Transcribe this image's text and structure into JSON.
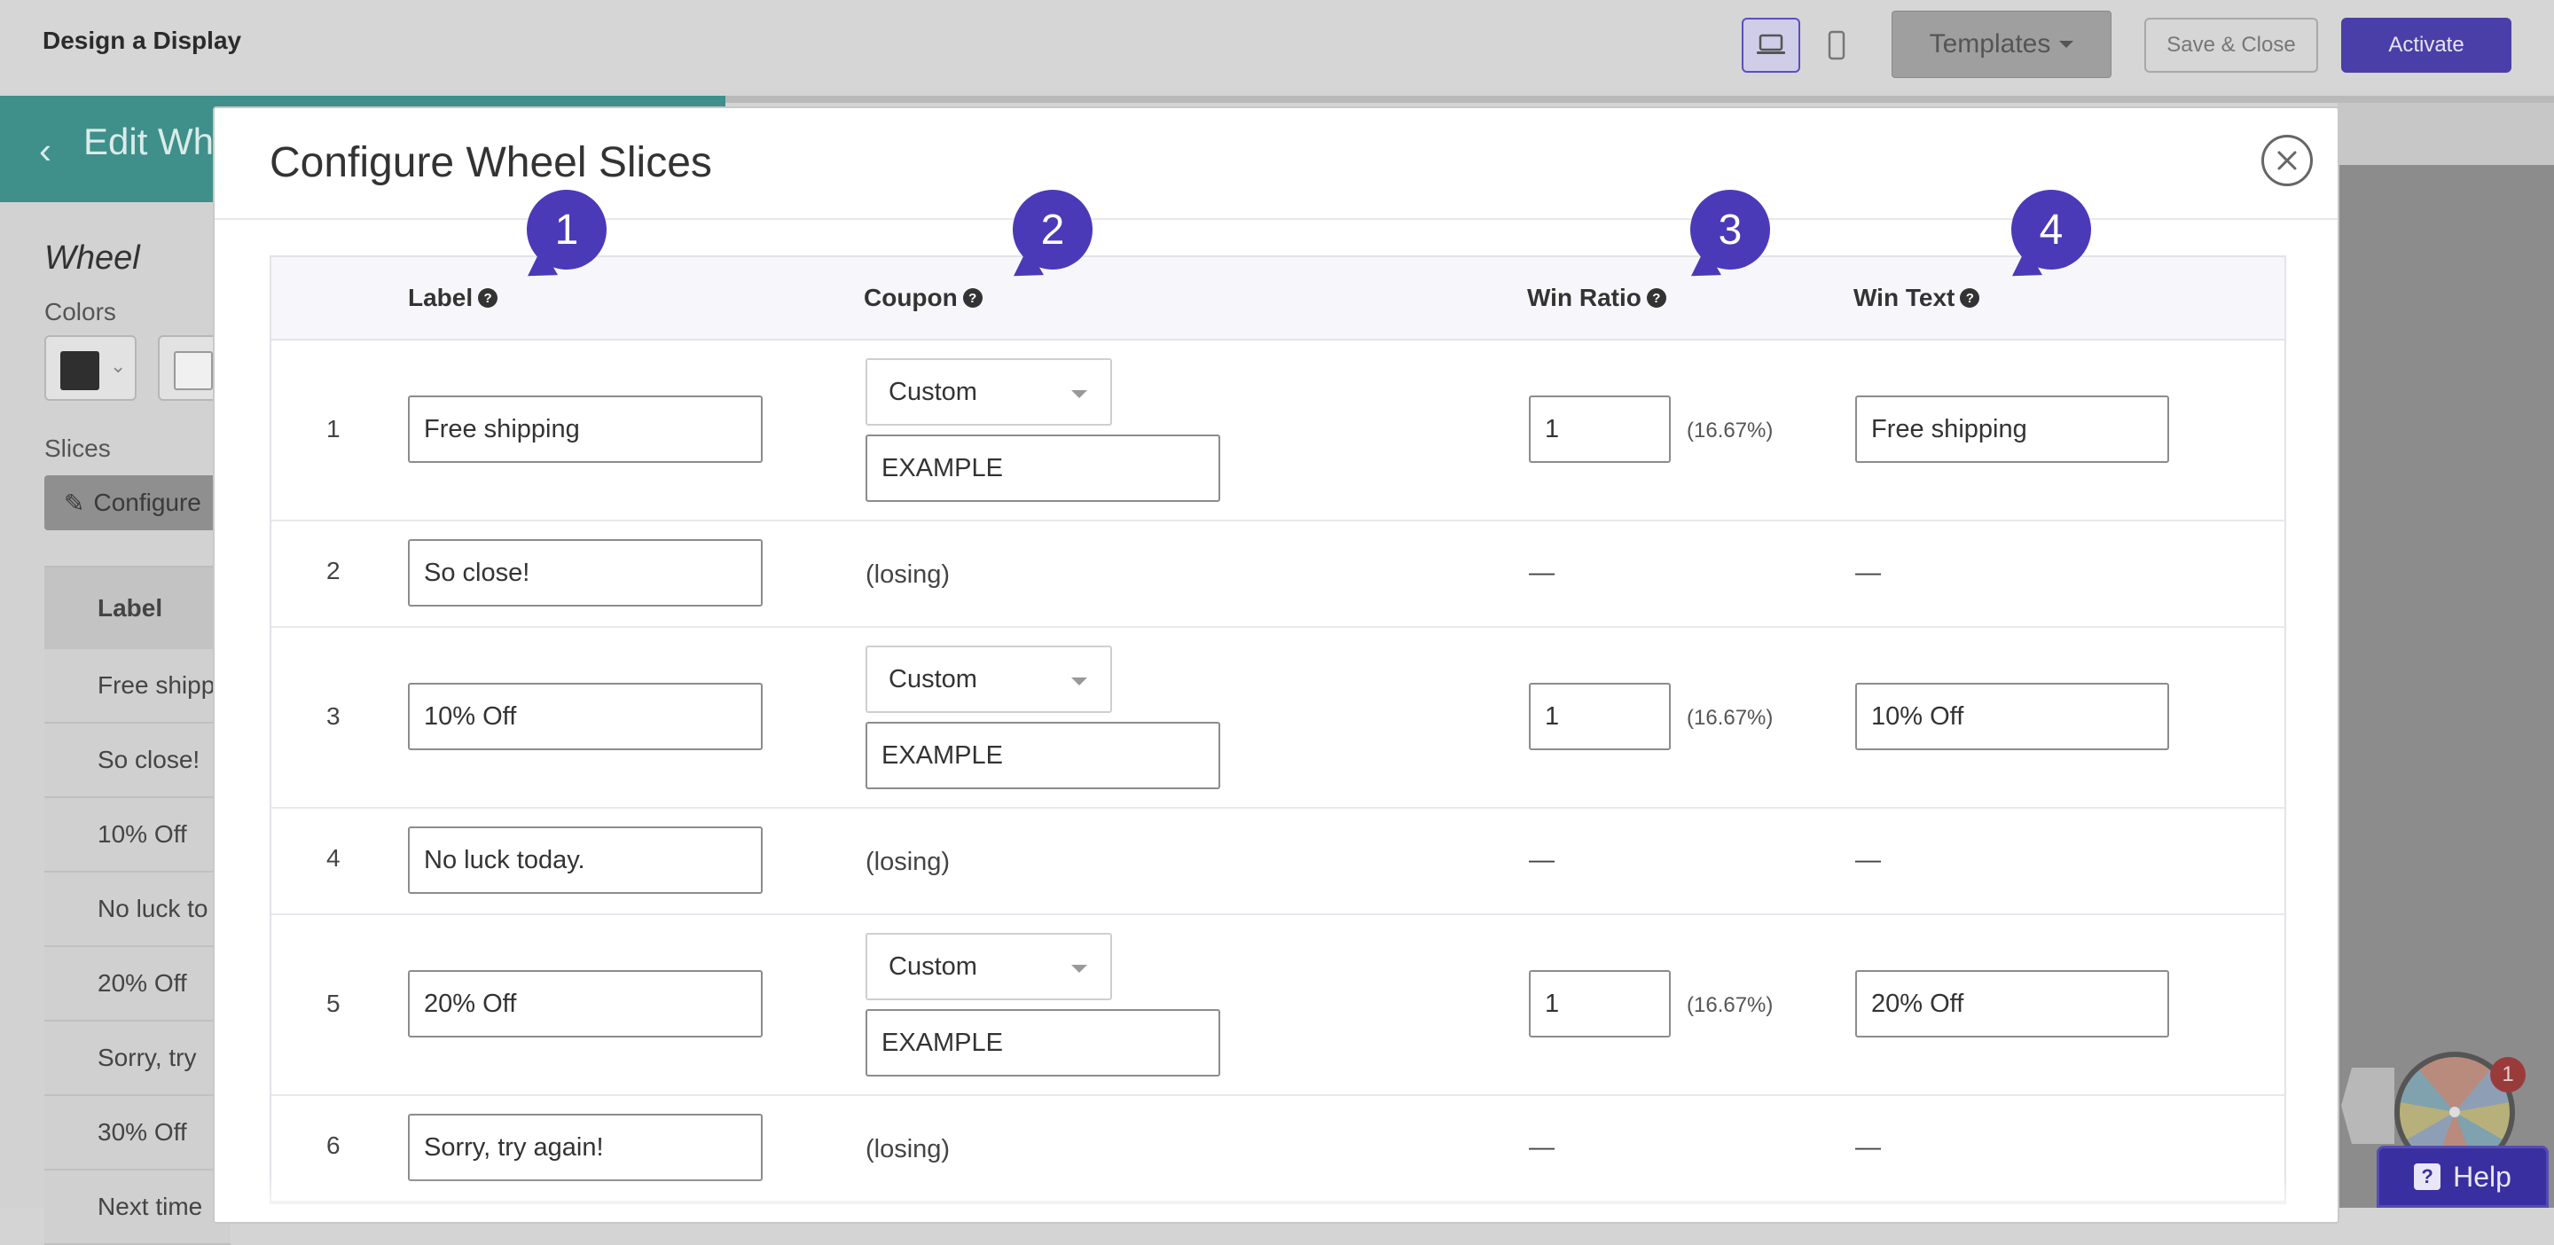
{
  "topbar": {
    "title": "Design a Display",
    "templates_label": "Templates",
    "save_close_label": "Save & Close",
    "activate_label": "Activate"
  },
  "editor": {
    "header_title": "Edit Wh",
    "section_title": "Wheel",
    "colors_label": "Colors",
    "slices_label": "Slices",
    "configure_label": "Configure",
    "table_header": "Label",
    "table_rows": [
      "Free shipp",
      "So close!",
      "10% Off",
      "No luck to",
      "20% Off",
      "Sorry, try",
      "30% Off",
      "Next time"
    ]
  },
  "modal": {
    "title": "Configure Wheel Slices",
    "columns": {
      "label": "Label",
      "coupon": "Coupon",
      "win_ratio": "Win Ratio",
      "win_text": "Win Text"
    },
    "rows": [
      {
        "num": "1",
        "label": "Free shipping",
        "type": "win",
        "coupon_type": "Custom",
        "coupon_code": "EXAMPLE",
        "ratio": "1",
        "pct": "(16.67%)",
        "win_text": "Free shipping"
      },
      {
        "num": "2",
        "label": "So close!",
        "type": "lose",
        "losing": "(losing)",
        "ratio_dash": "—",
        "text_dash": "—"
      },
      {
        "num": "3",
        "label": "10% Off",
        "type": "win",
        "coupon_type": "Custom",
        "coupon_code": "EXAMPLE",
        "ratio": "1",
        "pct": "(16.67%)",
        "win_text": "10% Off"
      },
      {
        "num": "4",
        "label": "No luck today.",
        "type": "lose",
        "losing": "(losing)",
        "ratio_dash": "—",
        "text_dash": "—"
      },
      {
        "num": "5",
        "label": "20% Off",
        "type": "win",
        "coupon_type": "Custom",
        "coupon_code": "EXAMPLE",
        "ratio": "1",
        "pct": "(16.67%)",
        "win_text": "20% Off"
      },
      {
        "num": "6",
        "label": "Sorry, try again!",
        "type": "lose",
        "losing": "(losing)",
        "ratio_dash": "—",
        "text_dash": "—"
      }
    ]
  },
  "annotations": [
    "1",
    "2",
    "3",
    "4"
  ],
  "widgets": {
    "help_label": "Help",
    "notification_count": "1"
  },
  "colors": {
    "accent": "#4a3ab8",
    "teal_header": "#3f8f8a"
  }
}
